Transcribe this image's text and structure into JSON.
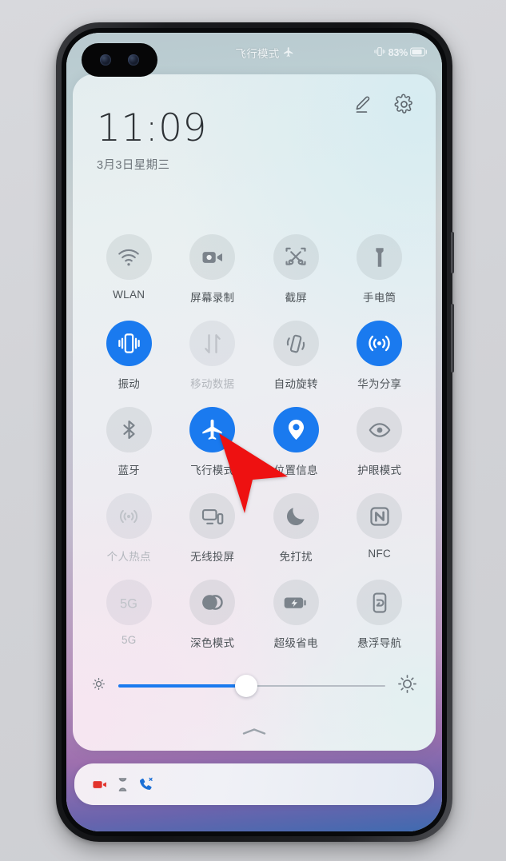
{
  "status_bar": {
    "center_text": "飞行模式",
    "center_icon": "airplane-icon",
    "battery_percent": "83%",
    "vibrate_icon": "vibrate-icon",
    "battery_icon": "battery-icon"
  },
  "panel": {
    "edit_icon": "pencil-edit-icon",
    "settings_icon": "gear-settings-icon",
    "time": "11:09",
    "date": "3月3日星期三",
    "collapse_icon": "chevron-up-icon"
  },
  "toggles": [
    {
      "label": "WLAN",
      "icon": "wifi-icon",
      "state": "off"
    },
    {
      "label": "屏幕录制",
      "icon": "screen-record-icon",
      "state": "off"
    },
    {
      "label": "截屏",
      "icon": "screenshot-icon",
      "state": "off"
    },
    {
      "label": "手电筒",
      "icon": "flashlight-icon",
      "state": "off"
    },
    {
      "label": "振动",
      "icon": "vibrate-icon",
      "state": "active"
    },
    {
      "label": "移动数据",
      "icon": "mobile-data-icon",
      "state": "disabled"
    },
    {
      "label": "自动旋转",
      "icon": "auto-rotate-icon",
      "state": "off"
    },
    {
      "label": "华为分享",
      "icon": "huawei-share-icon",
      "state": "active"
    },
    {
      "label": "蓝牙",
      "icon": "bluetooth-icon",
      "state": "off"
    },
    {
      "label": "飞行模式",
      "icon": "airplane-icon",
      "state": "active"
    },
    {
      "label": "位置信息",
      "icon": "location-pin-icon",
      "state": "active"
    },
    {
      "label": "护眼模式",
      "icon": "eye-comfort-icon",
      "state": "off"
    },
    {
      "label": "个人热点",
      "icon": "hotspot-icon",
      "state": "disabled"
    },
    {
      "label": "无线投屏",
      "icon": "cast-screen-icon",
      "state": "off"
    },
    {
      "label": "免打扰",
      "icon": "moon-dnd-icon",
      "state": "off"
    },
    {
      "label": "NFC",
      "icon": "nfc-icon",
      "state": "off"
    },
    {
      "label": "5G",
      "icon": "5g-icon",
      "state": "disabled"
    },
    {
      "label": "深色模式",
      "icon": "dark-mode-icon",
      "state": "off"
    },
    {
      "label": "超级省电",
      "icon": "super-power-save-icon",
      "state": "off"
    },
    {
      "label": "悬浮导航",
      "icon": "floating-nav-icon",
      "state": "off"
    }
  ],
  "brightness": {
    "value_percent": 48,
    "low_icon": "sun-small-icon",
    "high_icon": "sun-large-icon"
  },
  "notifications": [
    {
      "icon": "camcorder-icon"
    },
    {
      "icon": "hourglass-icon"
    },
    {
      "icon": "missed-call-icon"
    }
  ],
  "cursor": {
    "icon": "cursor-arrow-icon",
    "color": "#ee1111"
  },
  "colors": {
    "accent": "#1a7aef",
    "icon_off": "#7b838b",
    "icon_disabled": "#bfc3c9",
    "label": "#4d5358",
    "label_disabled": "#b3b7bd"
  }
}
